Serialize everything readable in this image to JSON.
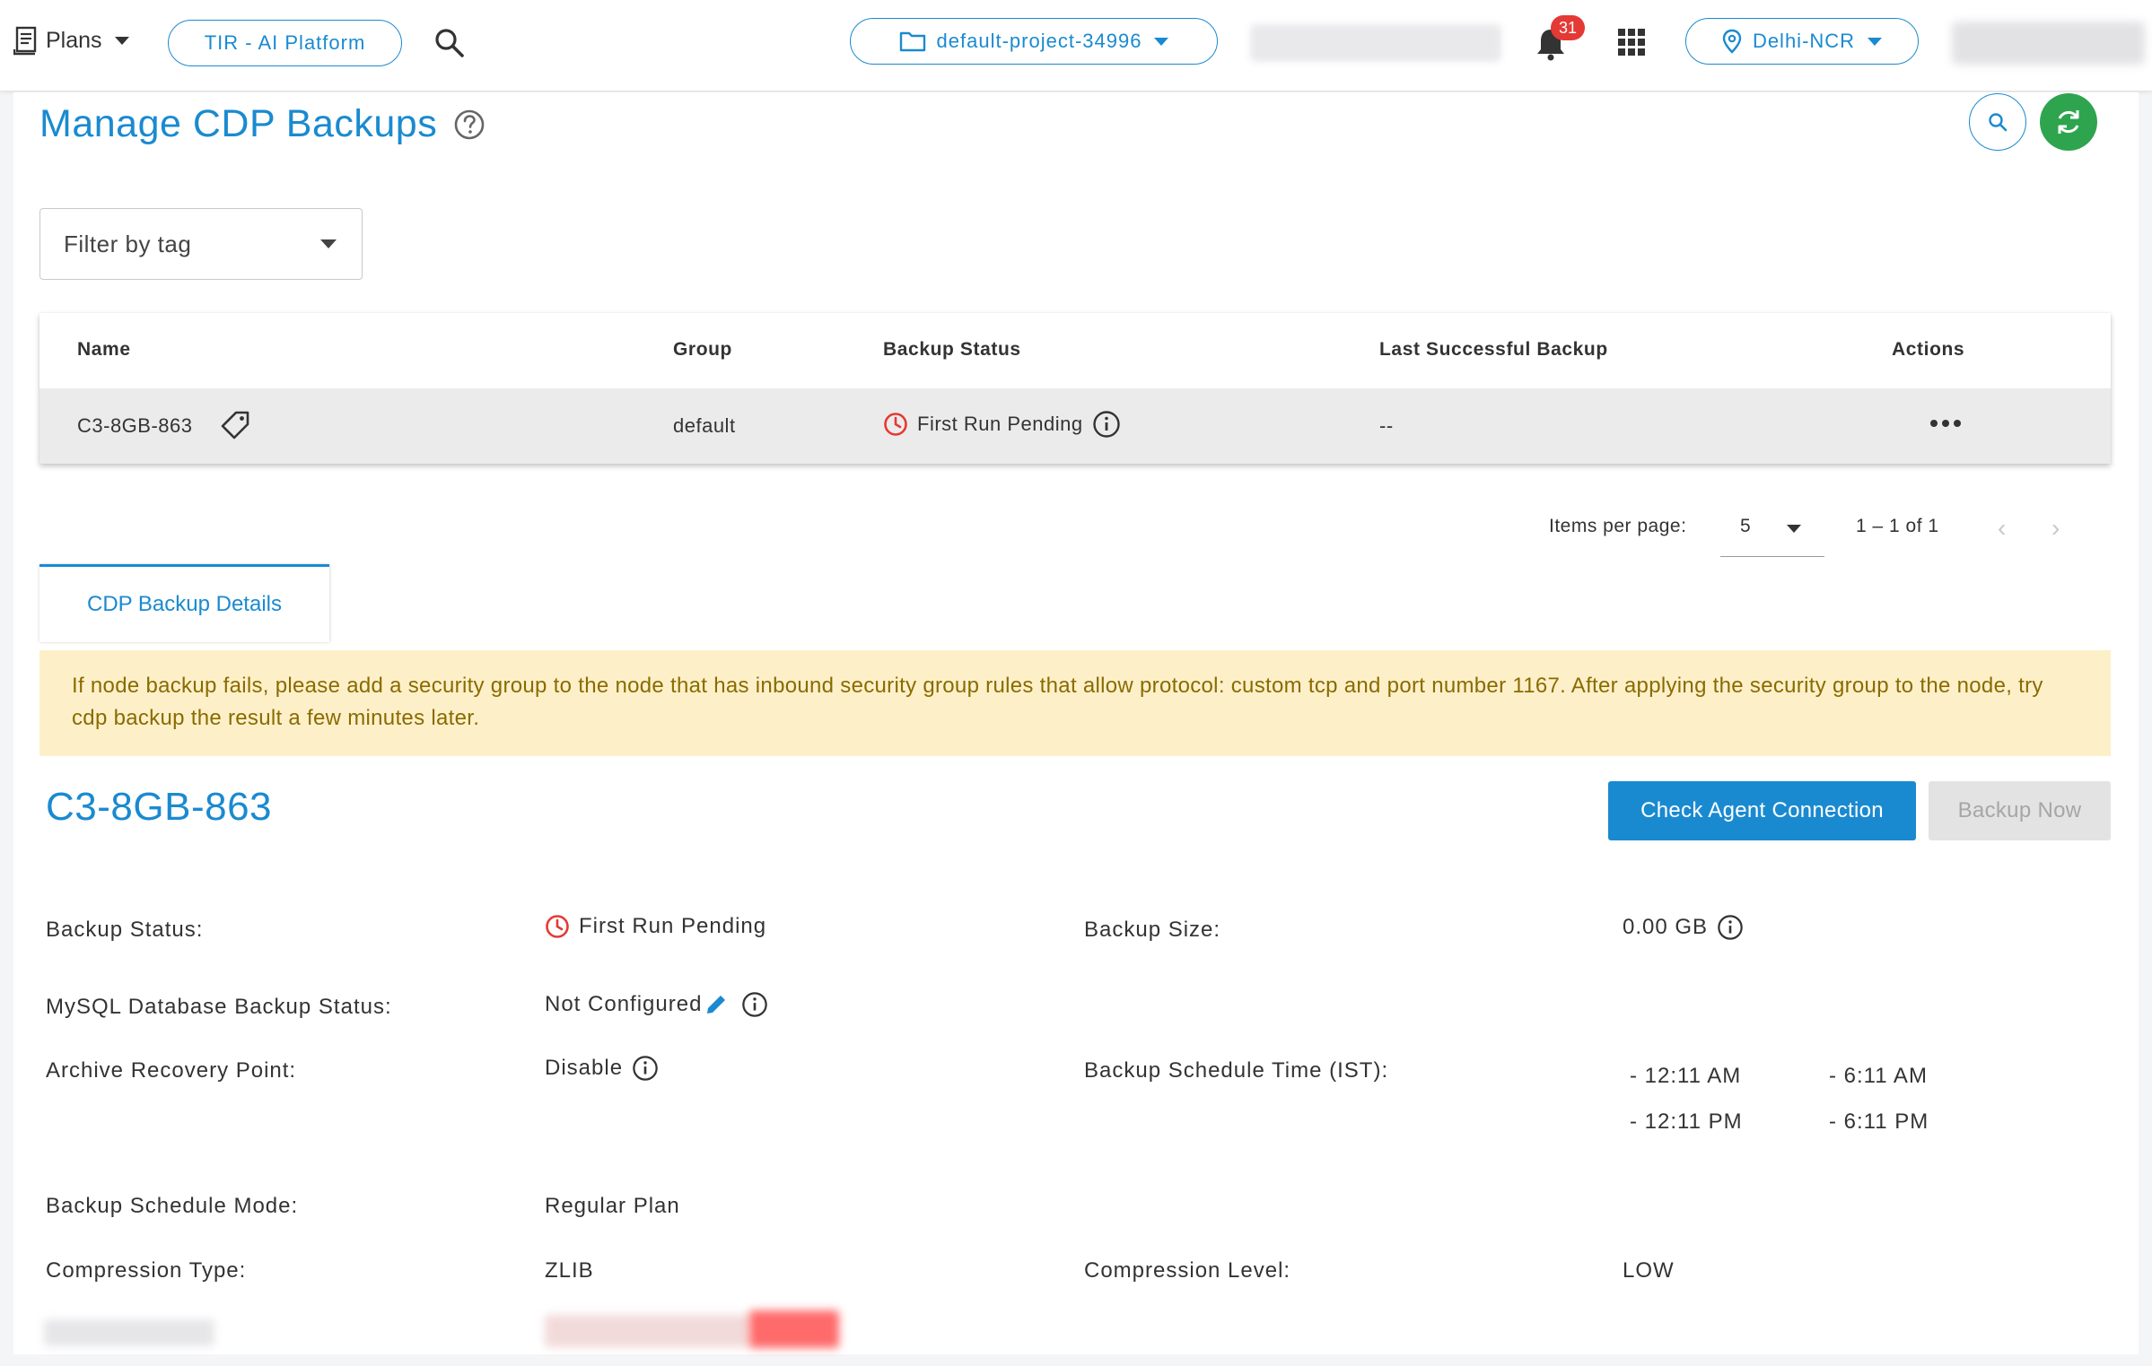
{
  "topbar": {
    "plans_label": "Plans",
    "platform_label": "TIR - AI Platform",
    "project_label": "default-project-34996",
    "notification_count": "31",
    "region_label": "Delhi-NCR"
  },
  "page": {
    "title": "Manage CDP Backups"
  },
  "filter": {
    "label": "Filter by tag"
  },
  "table": {
    "columns": [
      "Name",
      "Group",
      "Backup Status",
      "Last Successful Backup",
      "Actions"
    ],
    "rows": [
      {
        "name": "C3-8GB-863",
        "group": "default",
        "status": "First Run Pending",
        "last_backup": "--"
      }
    ]
  },
  "paginator": {
    "label": "Items per page:",
    "per_page": "5",
    "range": "1 – 1 of 1"
  },
  "tabs": [
    "CDP Backup Details"
  ],
  "alert": {
    "text": "If node backup fails, please add a security group to the node that has inbound security group rules that allow protocol: custom tcp and port number 1167. After applying the security group to the node, try cdp backup the result a few minutes later."
  },
  "detail": {
    "title": "C3-8GB-863",
    "check_agent_label": "Check Agent Connection",
    "backup_now_label": "Backup Now",
    "fields": {
      "backup_status_label": "Backup Status:",
      "backup_status_value": "First Run Pending",
      "backup_size_label": "Backup Size:",
      "backup_size_value": "0.00 GB",
      "mysql_label": "MySQL Database Backup Status:",
      "mysql_value": "Not Configured",
      "archive_label": "Archive Recovery Point:",
      "archive_value": "Disable",
      "schedule_time_label": "Backup Schedule Time (IST):",
      "schedule_times": [
        "- 12:11 AM",
        "- 6:11 AM",
        "- 12:11 PM",
        "- 6:11 PM"
      ],
      "schedule_mode_label": "Backup Schedule Mode:",
      "schedule_mode_value": "Regular Plan",
      "compression_type_label": "Compression Type:",
      "compression_type_value": "ZLIB",
      "compression_level_label": "Compression Level:",
      "compression_level_value": "LOW"
    }
  },
  "colors": {
    "accent": "#1a8ad0",
    "success": "#2ea44f",
    "danger": "#e53935",
    "alert_bg": "#fdf0c9",
    "alert_text": "#8a6b00"
  }
}
